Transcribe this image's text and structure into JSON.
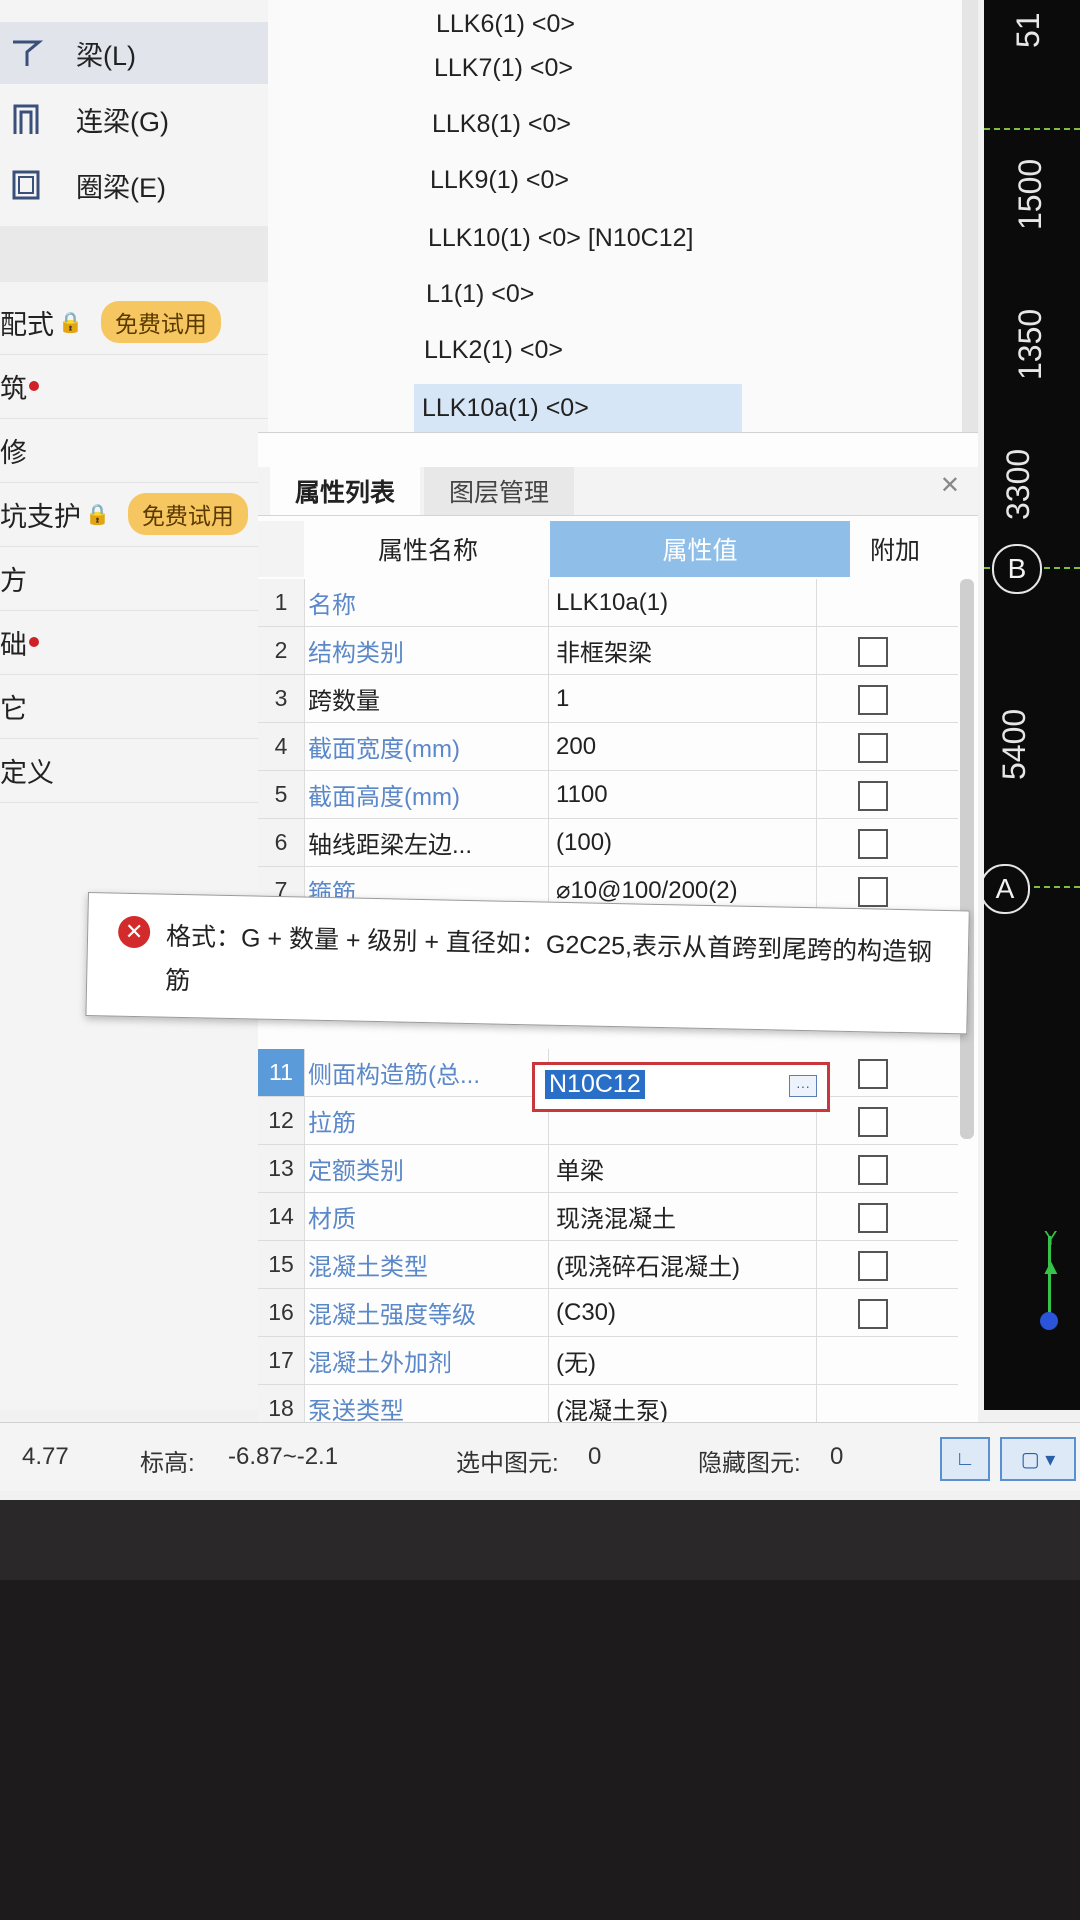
{
  "sidebar": {
    "items": [
      {
        "label": "梁(L)",
        "icon": "beam-icon",
        "active": true
      },
      {
        "label": "连梁(G)",
        "icon": "coupling-beam-icon",
        "active": false
      },
      {
        "label": "圈梁(E)",
        "icon": "ring-beam-icon",
        "active": false
      }
    ],
    "rows": [
      {
        "label": "配式",
        "lock": true,
        "badge": "免费试用"
      },
      {
        "label": "筑",
        "dot": true
      },
      {
        "label": "修"
      },
      {
        "label": "坑支护",
        "lock": true,
        "badge": "免费试用"
      },
      {
        "label": "方"
      },
      {
        "label": "础",
        "dot": true
      },
      {
        "label": "它"
      },
      {
        "label": "定义"
      }
    ]
  },
  "component_list": {
    "items": [
      "LLK6(1) <0>",
      "LLK7(1) <0>",
      "LLK8(1) <0>",
      "LLK9(1) <0>",
      "LLK10(1) <0> [N10C12]",
      "L1(1) <0>",
      "LLK2(1) <0>",
      "LLK10a(1) <0>"
    ],
    "selected_index": 7
  },
  "properties": {
    "tabs": [
      "属性列表",
      "图层管理"
    ],
    "active_tab": 0,
    "headers": {
      "name": "属性名称",
      "value": "属性值",
      "extra": "附加"
    },
    "rows": [
      {
        "num": "1",
        "name": "名称",
        "value": "LLK10a(1)",
        "blue": true,
        "checkbox": false
      },
      {
        "num": "2",
        "name": "结构类别",
        "value": "非框架梁",
        "blue": true,
        "checkbox": true
      },
      {
        "num": "3",
        "name": "跨数量",
        "value": "1",
        "blue": false,
        "checkbox": true
      },
      {
        "num": "4",
        "name": "截面宽度(mm)",
        "value": "200",
        "blue": true,
        "checkbox": true
      },
      {
        "num": "5",
        "name": "截面高度(mm)",
        "value": "1100",
        "blue": true,
        "checkbox": true
      },
      {
        "num": "6",
        "name": "轴线距梁左边...",
        "value": "(100)",
        "blue": false,
        "checkbox": true
      },
      {
        "num": "7",
        "name": "箍筋",
        "value": "⌀10@100/200(2)",
        "blue": true,
        "checkbox": true
      },
      {
        "num": "11",
        "name": "侧面构造筋(总...",
        "value": "N10C12",
        "blue": true,
        "checkbox": true,
        "editing": true
      },
      {
        "num": "12",
        "name": "拉筋",
        "value": "",
        "blue": true,
        "checkbox": true
      },
      {
        "num": "13",
        "name": "定额类别",
        "value": "单梁",
        "blue": true,
        "checkbox": true
      },
      {
        "num": "14",
        "name": "材质",
        "value": "现浇混凝土",
        "blue": true,
        "checkbox": true
      },
      {
        "num": "15",
        "name": "混凝土类型",
        "value": "(现浇碎石混凝土)",
        "blue": true,
        "checkbox": true
      },
      {
        "num": "16",
        "name": "混凝土强度等级",
        "value": "(C30)",
        "blue": true,
        "checkbox": true
      },
      {
        "num": "17",
        "name": "混凝土外加剂",
        "value": "(无)",
        "blue": true,
        "checkbox": false
      },
      {
        "num": "18",
        "name": "泵送类型",
        "value": "(混凝土泵)",
        "blue": true,
        "checkbox": false
      }
    ]
  },
  "tooltip": {
    "text": "格式：G + 数量 + 级别 + 直径如：G2C25,表示从首跨到尾跨的构造钢筋"
  },
  "statusbar": {
    "value": "4.77",
    "elevation_label": "标高:",
    "elevation_value": "-6.87~-2.1",
    "selected_label": "选中图元:",
    "selected_value": "0",
    "hidden_label": "隐藏图元:",
    "hidden_value": "0"
  },
  "canvas": {
    "dims": [
      "51",
      "1500",
      "1350",
      "3300",
      "5400"
    ],
    "axis_labels": [
      "B",
      "A"
    ],
    "y_axis_label": "Y"
  },
  "colors": {
    "accent": "#5b88c9",
    "error": "#d32b2b",
    "badge": "#f6c760",
    "selection": "#d6e6f6"
  }
}
